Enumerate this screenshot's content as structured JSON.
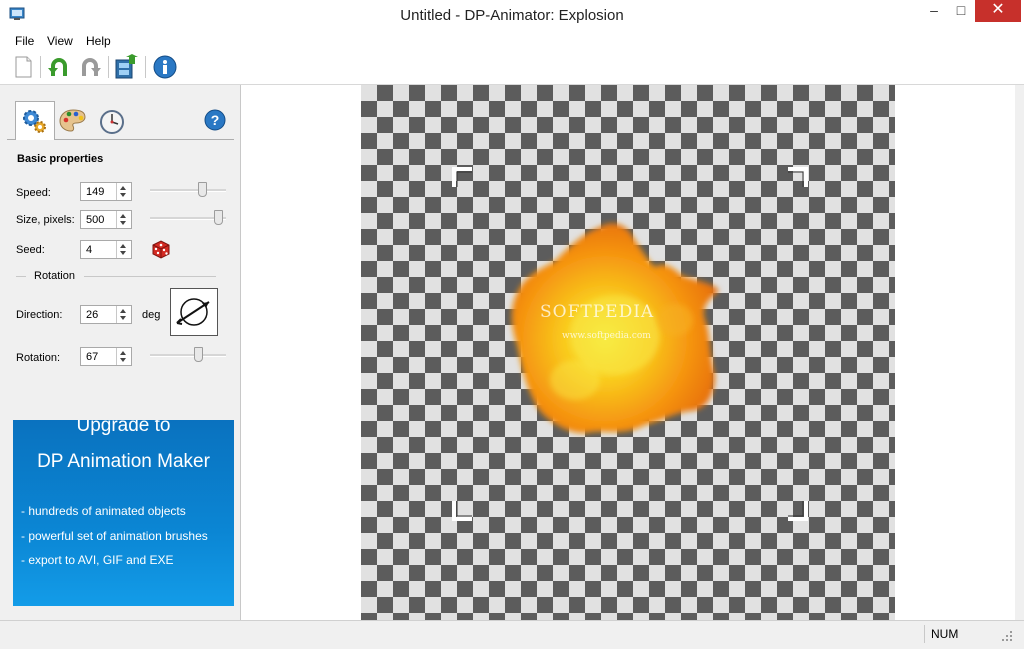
{
  "window": {
    "title": "Untitled - DP-Animator: Explosion",
    "min": "–",
    "max": "□",
    "close": "✕"
  },
  "menu": {
    "file": "File",
    "view": "View",
    "help": "Help"
  },
  "toolbar": {
    "icons": [
      "new-icon",
      "undo-icon",
      "redo-icon",
      "export-icon",
      "info-icon"
    ]
  },
  "panel": {
    "tabs": [
      "properties-tab",
      "colors-tab",
      "timing-tab"
    ],
    "section_title": "Basic properties",
    "speed": {
      "label": "Speed:",
      "value": "149",
      "level": 0.72
    },
    "size": {
      "label": "Size, pixels:",
      "value": "500",
      "level": 0.95
    },
    "seed": {
      "label": "Seed:",
      "value": "4"
    },
    "rotation_group": "Rotation",
    "direction": {
      "label": "Direction:",
      "value": "26",
      "unit": "deg"
    },
    "rotation": {
      "label": "Rotation:",
      "value": "67",
      "level": 0.65
    }
  },
  "promo": {
    "heading1": "Upgrade to",
    "heading2": "DP Animation Maker",
    "bullets": [
      "- hundreds of animated objects",
      "- powerful set of animation brushes",
      "- export to AVI, GIF and EXE"
    ]
  },
  "canvas": {
    "watermark": "SOFTPEDIA",
    "watermark_sub": "www.softpedia.com"
  },
  "status": {
    "num": "NUM"
  },
  "colors": {
    "promo": "#0b86d4",
    "close": "#c7302b"
  }
}
